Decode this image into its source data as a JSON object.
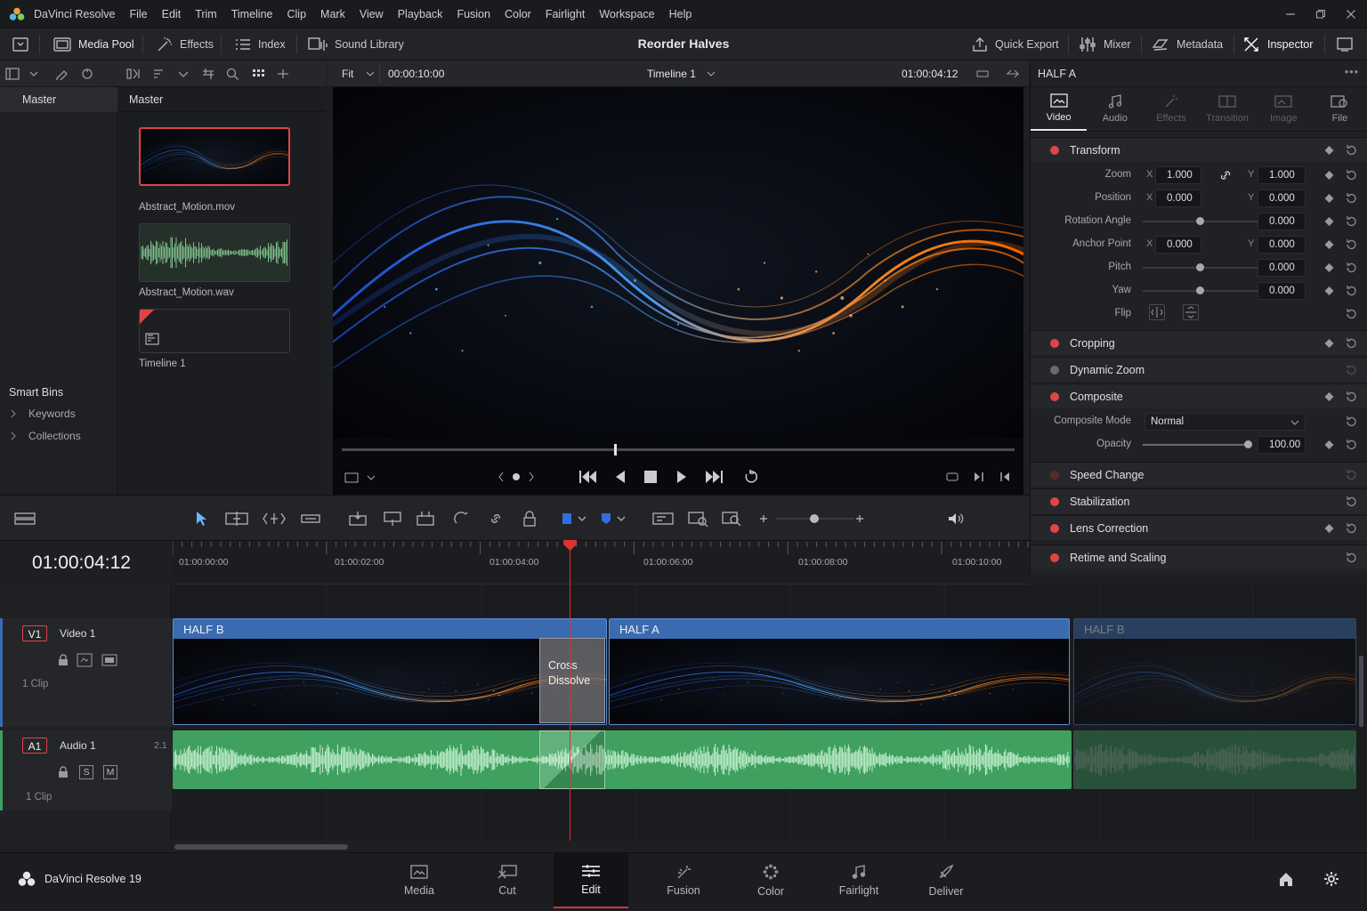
{
  "app": {
    "title": "DaVinci Resolve",
    "version_label": "DaVinci Resolve 19"
  },
  "menu": [
    "File",
    "Edit",
    "Trim",
    "Timeline",
    "Clip",
    "Mark",
    "View",
    "Playback",
    "Fusion",
    "Color",
    "Fairlight",
    "Workspace",
    "Help"
  ],
  "toolbar": {
    "media_pool": "Media Pool",
    "effects": "Effects",
    "index": "Index",
    "sound_library": "Sound Library",
    "project_title": "Reorder Halves",
    "quick_export": "Quick Export",
    "mixer": "Mixer",
    "metadata": "Metadata",
    "inspector": "Inspector"
  },
  "bins": {
    "master": "Master",
    "smart_bins": "Smart Bins",
    "items": [
      "Keywords",
      "Collections"
    ]
  },
  "media_pool": {
    "header": "Master",
    "clips": [
      {
        "name": "Abstract_Motion.mov",
        "kind": "video",
        "selected": true
      },
      {
        "name": "Abstract_Motion.wav",
        "kind": "audio"
      },
      {
        "name": "Timeline 1",
        "kind": "timeline"
      }
    ]
  },
  "viewer": {
    "zoom": "Fit",
    "source_timecode": "00:00:10:00",
    "timeline_name": "Timeline 1",
    "record_timecode": "01:00:04:12",
    "playhead_fraction": 0.405
  },
  "inspector": {
    "clip_name": "HALF A",
    "tabs": [
      {
        "label": "Video",
        "icon": "video-icon",
        "active": true
      },
      {
        "label": "Audio",
        "icon": "music-note-icon"
      },
      {
        "label": "Effects",
        "icon": "wand-icon"
      },
      {
        "label": "Transition",
        "icon": "transition-icon"
      },
      {
        "label": "Image",
        "icon": "image-icon"
      },
      {
        "label": "File",
        "icon": "file-icon"
      }
    ],
    "transform": {
      "title": "Transform",
      "zoom": {
        "label": "Zoom",
        "x": "1.000",
        "y": "1.000"
      },
      "position": {
        "label": "Position",
        "x": "0.000",
        "y": "0.000"
      },
      "rotation": {
        "label": "Rotation Angle",
        "value": "0.000"
      },
      "anchor": {
        "label": "Anchor Point",
        "x": "0.000",
        "y": "0.000"
      },
      "pitch": {
        "label": "Pitch",
        "value": "0.000"
      },
      "yaw": {
        "label": "Yaw",
        "value": "0.000"
      },
      "flip": {
        "label": "Flip"
      },
      "x_label": "X",
      "y_label": "Y"
    },
    "cropping": "Cropping",
    "dynamic_zoom": "Dynamic Zoom",
    "composite": {
      "title": "Composite",
      "mode_label": "Composite Mode",
      "mode": "Normal",
      "opacity_label": "Opacity",
      "opacity": "100.00",
      "opacity_fraction": 1.0
    },
    "speed_change": "Speed Change",
    "stabilization": "Stabilization",
    "lens_correction": "Lens Correction",
    "retime": "Retime and Scaling"
  },
  "timeline": {
    "timecode": "01:00:04:12",
    "ruler": [
      "01:00:00:00",
      "01:00:02:00",
      "01:00:04:00",
      "01:00:06:00",
      "01:00:08:00",
      "01:00:10:00"
    ],
    "tracks": {
      "v1": {
        "id": "V1",
        "name": "Video 1",
        "clips": "1 Clip"
      },
      "a1": {
        "id": "A1",
        "name": "Audio 1",
        "channels": "2.1",
        "clips": "1 Clip",
        "solo": "S",
        "mute": "M"
      }
    },
    "video_clips": [
      "HALF B",
      "HALF A",
      "HALF B"
    ],
    "transition": {
      "line1": "Cross",
      "line2": "Dissolve"
    }
  },
  "pages": [
    {
      "label": "Media",
      "icon": "media-page-icon"
    },
    {
      "label": "Cut",
      "icon": "cut-page-icon"
    },
    {
      "label": "Edit",
      "icon": "edit-page-icon",
      "active": true
    },
    {
      "label": "Fusion",
      "icon": "fusion-page-icon"
    },
    {
      "label": "Color",
      "icon": "color-page-icon"
    },
    {
      "label": "Fairlight",
      "icon": "fairlight-page-icon"
    },
    {
      "label": "Deliver",
      "icon": "deliver-page-icon"
    }
  ],
  "colors": {
    "accent_blue": "#3a6bb0",
    "audio_green": "#3fa060",
    "playhead_red": "#e03030",
    "enable_dot": "#e04545"
  }
}
